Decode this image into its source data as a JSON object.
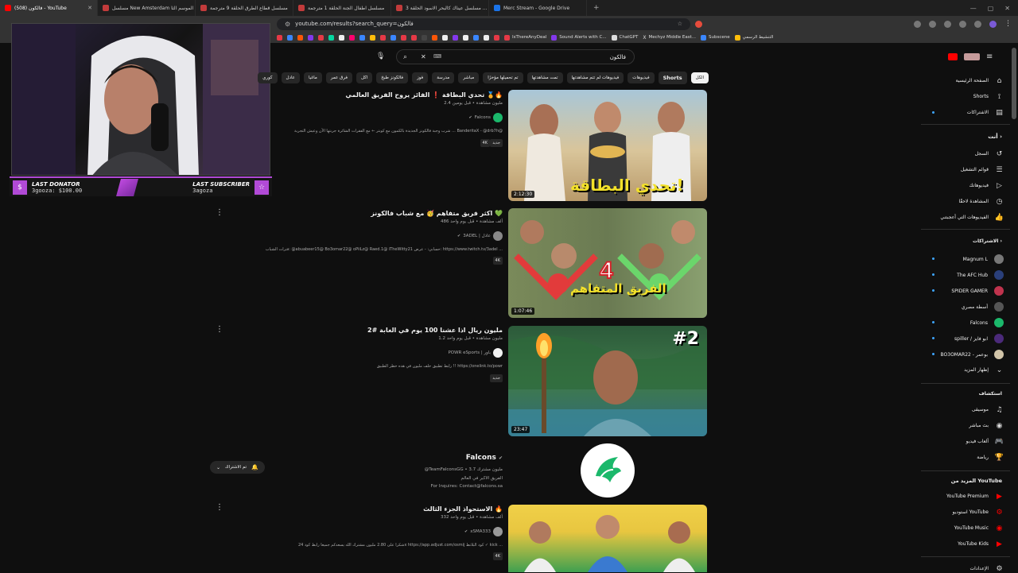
{
  "browser": {
    "tabs": [
      {
        "label": "(508) فالكون - YouTube",
        "active": true,
        "color": "#ff0000"
      },
      {
        "label": "مسلسل New Amsterdam الموسم الثا",
        "active": false,
        "color": "#c23b3b"
      },
      {
        "label": "مسلسل قطاع الطرق الحلقة 9 مترجمة",
        "active": false,
        "color": "#c23b3b"
      },
      {
        "label": "مسلسل اطفال الجنة الحلقة 1 مترجمة",
        "active": false,
        "color": "#c23b3b"
      },
      {
        "label": "مسلسل عيناك كالبحر الاسود الحلقة 3 ...",
        "active": false,
        "color": "#c23b3b"
      },
      {
        "label": "Merc Stream - Google Drive",
        "active": false,
        "color": "#1a73e8"
      }
    ],
    "url": "youtube.com/results?search_query=فالكون",
    "bookmarks": [
      "IsThereAnyDeal",
      "Sound Alerts with C...",
      "ChatGPT",
      "Mechyz Middle East...",
      "Subscene",
      "التنشيط الرسمي"
    ]
  },
  "stream_overlay": {
    "last_donator_label": "LAST DONATOR",
    "last_donator_value": "3gooza: $100.00",
    "last_subscriber_label": "LAST SUBSCRIBER",
    "last_subscriber_value": "3agoza"
  },
  "search": {
    "query": "فالكون"
  },
  "chips": [
    {
      "label": "الكل",
      "selected": true
    },
    {
      "label": "Shorts",
      "selected": false
    },
    {
      "label": "فيديوهات",
      "selected": false
    },
    {
      "label": "فيديوهات لم تتم مشاهدتها",
      "selected": false
    },
    {
      "label": "تمت مشاهدتها",
      "selected": false
    },
    {
      "label": "تم تحميلها مؤخرًا",
      "selected": false
    },
    {
      "label": "مباشر",
      "selected": false
    },
    {
      "label": "مدرسة",
      "selected": false
    },
    {
      "label": "فوز",
      "selected": false
    },
    {
      "label": "فالكونز طبخ",
      "selected": false
    },
    {
      "label": "اكل",
      "selected": false
    },
    {
      "label": "فرق عمر",
      "selected": false
    },
    {
      "label": "ماغيا",
      "selected": false
    },
    {
      "label": "عادل",
      "selected": false
    },
    {
      "label": "كوري",
      "selected": false
    }
  ],
  "results": [
    {
      "title": "تحدي البطاقة ❗ الفائز يروح الفريق العالمي 🏅🔥",
      "meta": "2.4 مليون مشاهدة • قبل يومين",
      "channel": "Falcons",
      "desc": "شرب وجبة فالكونز الجديدة بالكمون مع كوبتر ← مع الفقرات الشائرة جربتها الأن وعيش التجربة ... BanderitaX - @drb7h@",
      "badge": "4K",
      "badge2": "جديد",
      "duration": "2:12:30",
      "thumb_text": "تحدي البطاقة!"
    },
    {
      "title": "اكثر فريق متفاهم 🥳 مع شباب فالكونز 💚",
      "meta": "486 ألف مشاهدة • قبل يوم واحد",
      "channel": "3ADEL | عادل",
      "desc": "فترات الشباب: @abuabeer15@ Bo3omar22@ oPiiLz@ Raed.1@ iTheWitty21 حسابي: - عرض: https://www.twitch.tv/3adel ...",
      "badge": "4K",
      "badge2": "",
      "duration": "1:07:46",
      "thumb_text": "الفريق المتفاهم"
    },
    {
      "title": "مليون ريال اذا عشنا 100 يوم في الغابة #2",
      "meta": "1.2 مليون مشاهدة • قبل يوم واحد",
      "channel": "POWR eSports | باور",
      "desc": "رابط تطبيق خلف مليون في هذه خطر الطبيق !! https://onelink.to/powr",
      "badge": "جديد",
      "badge2": "",
      "duration": "23:47",
      "thumb_text": "#2"
    },
    {
      "title": "الاستحواذ الجزء الثالث 🔥",
      "meta": "332 ألف مشاهدة • قبل يوم واحد",
      "channel": "xSMA333",
      "desc": "شكرا على 2.80 مليون مشترك الله يسعدكم جميعا رابط كود 24x https://app.adjust.com/osmij كود البلانط ✓ kick ...",
      "badge": "4K",
      "badge2": "",
      "duration": "",
      "thumb_text": ""
    }
  ],
  "channel_result": {
    "name": "Falcons",
    "meta": "@TeamFalconsGG • 3.7 مليون مشترك",
    "desc": "الفريق الاكبر في العالم",
    "inquiries": "For Inquires: Contact@falcons.sa",
    "subscribed_label": "تم الاشتراك"
  },
  "sidebar": {
    "main": [
      {
        "label": "الصفحة الرئيسية",
        "icon": "home-icon"
      },
      {
        "label": "Shorts",
        "icon": "shorts-icon"
      },
      {
        "label": "الاشتراكات",
        "icon": "subscriptions-icon"
      }
    ],
    "you_header": "أنت",
    "you": [
      {
        "label": "السجل",
        "icon": "history-icon"
      },
      {
        "label": "قوائم التشغيل",
        "icon": "playlist-icon"
      },
      {
        "label": "فيديوهاتك",
        "icon": "your-videos-icon"
      },
      {
        "label": "المشاهدة لاحقًا",
        "icon": "watch-later-icon"
      },
      {
        "label": "الفيديوهات التي أعجبتني",
        "icon": "liked-icon"
      }
    ],
    "subs_header": "الاشتراكات",
    "subs": [
      {
        "label": "Magnum L",
        "color": "#777"
      },
      {
        "label": "The AFC Hub",
        "color": "#2a3f7a"
      },
      {
        "label": "SPIDER GAMER",
        "color": "#c0334d"
      },
      {
        "label": "أسطة مصري",
        "color": "#555"
      },
      {
        "label": "Falcons",
        "color": "#1bb86b"
      },
      {
        "label": "spiller / ابو فايز",
        "color": "#4b2a7a"
      },
      {
        "label": "BO3OMAR22 - بوعمر",
        "color": "#d1c4a8"
      }
    ],
    "show_more": "إظهار المزيد",
    "explore_header": "استكشاف",
    "explore": [
      {
        "label": "موسيقى",
        "icon": "music-icon"
      },
      {
        "label": "بث مباشر",
        "icon": "live-icon"
      },
      {
        "label": "ألعاب فيديو",
        "icon": "gaming-icon"
      },
      {
        "label": "رياضة",
        "icon": "sports-icon"
      }
    ],
    "more_header": "المزيد من YouTube",
    "more": [
      {
        "label": "YouTube Premium"
      },
      {
        "label": "استوديو YouTube"
      },
      {
        "label": "YouTube Music"
      },
      {
        "label": "YouTube Kids"
      }
    ],
    "settings": "الإعدادات"
  },
  "colors": {
    "accent": "#ff0000",
    "overlay_purple": "#b14ad6",
    "verified_green": "#1bb86b"
  }
}
